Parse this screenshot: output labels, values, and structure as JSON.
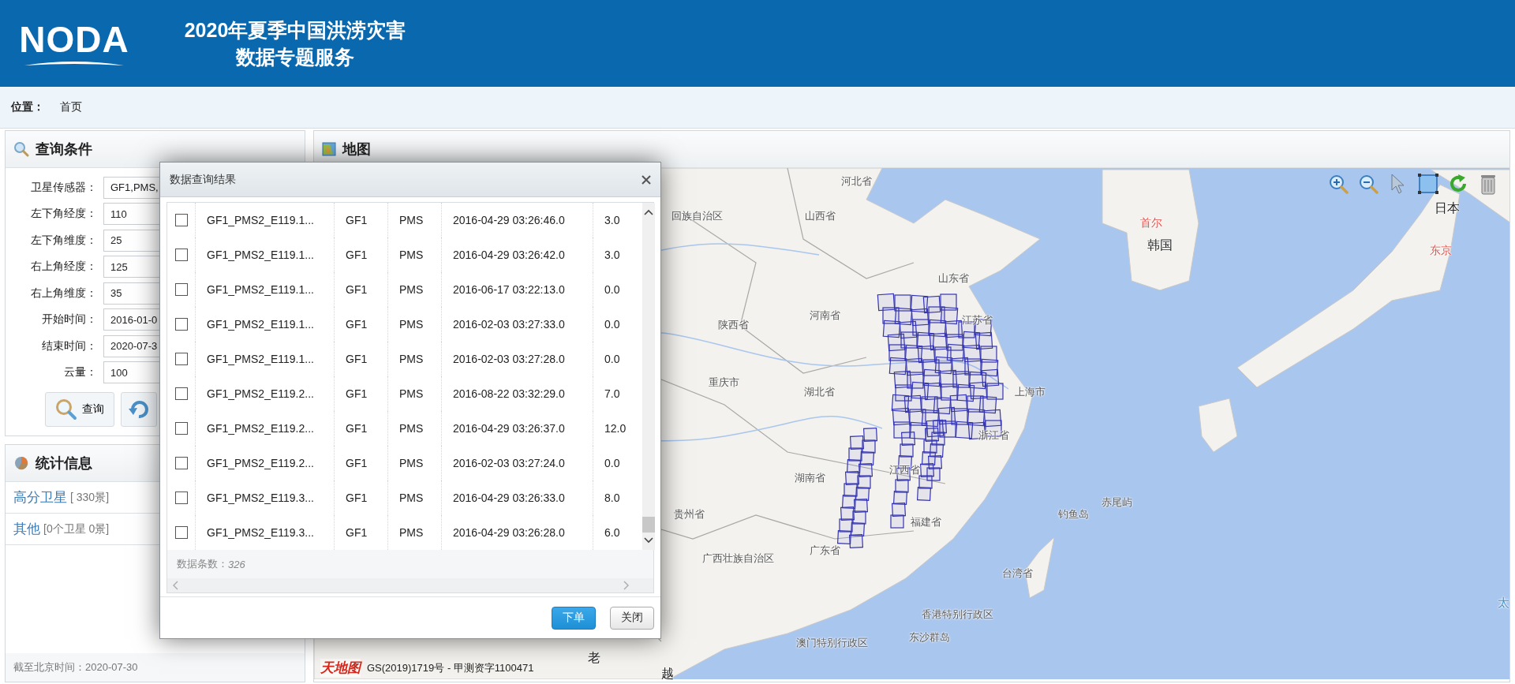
{
  "header": {
    "logo": "NODA",
    "title_lines": [
      "2020年夏季中国洪涝灾害",
      "数据专题服务"
    ]
  },
  "breadcrumb": {
    "label": "位置：",
    "current": "首页"
  },
  "query_panel": {
    "title": "查询条件",
    "fields": [
      {
        "label": "卫星传感器：",
        "value": "GF1,PMS,"
      },
      {
        "label": "左下角经度：",
        "value": "110"
      },
      {
        "label": "左下角维度：",
        "value": "25"
      },
      {
        "label": "右上角经度：",
        "value": "125"
      },
      {
        "label": "右上角维度：",
        "value": "35"
      },
      {
        "label": "开始时间：",
        "value": "2016-01-0"
      },
      {
        "label": "结束时间：",
        "value": "2020-07-3"
      },
      {
        "label": "云量：",
        "value": "100"
      }
    ],
    "search_button": "查询"
  },
  "stats_panel": {
    "title": "统计信息",
    "items": [
      {
        "name": "高分卫星",
        "detail": "[ 330景]"
      },
      {
        "name": "其他",
        "detail": "[0个卫星 0景]"
      }
    ],
    "footer": "截至北京时间：2020-07-30"
  },
  "map_panel": {
    "title": "地图",
    "labels": [
      {
        "text": "河北省",
        "kind": "region"
      },
      {
        "text": "山西省",
        "kind": "region"
      },
      {
        "text": "回族自治区",
        "kind": "region"
      },
      {
        "text": "山东省",
        "kind": "region"
      },
      {
        "text": "河南省",
        "kind": "region"
      },
      {
        "text": "江苏省",
        "kind": "region"
      },
      {
        "text": "陕西省",
        "kind": "region"
      },
      {
        "text": "重庆市",
        "kind": "region"
      },
      {
        "text": "湖北省",
        "kind": "region"
      },
      {
        "text": "上海市",
        "kind": "region"
      },
      {
        "text": "浙江省",
        "kind": "region"
      },
      {
        "text": "湖南省",
        "kind": "region"
      },
      {
        "text": "江西省",
        "kind": "region"
      },
      {
        "text": "贵州省",
        "kind": "region"
      },
      {
        "text": "福建省",
        "kind": "region"
      },
      {
        "text": "广西壮族自治区",
        "kind": "region"
      },
      {
        "text": "广东省",
        "kind": "region"
      },
      {
        "text": "钓鱼岛",
        "kind": "region"
      },
      {
        "text": "赤尾屿",
        "kind": "region"
      },
      {
        "text": "台湾省",
        "kind": "region"
      },
      {
        "text": "香港特别行政区",
        "kind": "region"
      },
      {
        "text": "澳门特别行政区",
        "kind": "region"
      },
      {
        "text": "东沙群岛",
        "kind": "region"
      },
      {
        "text": "首尔",
        "kind": "city"
      },
      {
        "text": "韩国",
        "kind": "country"
      },
      {
        "text": "日本",
        "kind": "country"
      },
      {
        "text": "东京",
        "kind": "city"
      },
      {
        "text": "太",
        "kind": "ocean"
      },
      {
        "text": "老",
        "kind": "country"
      },
      {
        "text": "越",
        "kind": "country"
      }
    ],
    "attribution": {
      "logo": "天地图",
      "text": "GS(2019)1719号 - 甲测资字1100471"
    }
  },
  "dialog": {
    "title": "数据查询结果",
    "rows": [
      {
        "checked": false,
        "name": "GF1_PMS2_E119.1...",
        "satellite": "GF1",
        "sensor": "PMS",
        "time": "2016-04-29 03:26:46.0",
        "cloud": "3.0"
      },
      {
        "checked": false,
        "name": "GF1_PMS2_E119.1...",
        "satellite": "GF1",
        "sensor": "PMS",
        "time": "2016-04-29 03:26:42.0",
        "cloud": "3.0"
      },
      {
        "checked": false,
        "name": "GF1_PMS2_E119.1...",
        "satellite": "GF1",
        "sensor": "PMS",
        "time": "2016-06-17 03:22:13.0",
        "cloud": "0.0"
      },
      {
        "checked": false,
        "name": "GF1_PMS2_E119.1...",
        "satellite": "GF1",
        "sensor": "PMS",
        "time": "2016-02-03 03:27:33.0",
        "cloud": "0.0"
      },
      {
        "checked": false,
        "name": "GF1_PMS2_E119.1...",
        "satellite": "GF1",
        "sensor": "PMS",
        "time": "2016-02-03 03:27:28.0",
        "cloud": "0.0"
      },
      {
        "checked": false,
        "name": "GF1_PMS2_E119.2...",
        "satellite": "GF1",
        "sensor": "PMS",
        "time": "2016-08-22 03:32:29.0",
        "cloud": "7.0"
      },
      {
        "checked": false,
        "name": "GF1_PMS2_E119.2...",
        "satellite": "GF1",
        "sensor": "PMS",
        "time": "2016-04-29 03:26:37.0",
        "cloud": "12.0"
      },
      {
        "checked": false,
        "name": "GF1_PMS2_E119.2...",
        "satellite": "GF1",
        "sensor": "PMS",
        "time": "2016-02-03 03:27:24.0",
        "cloud": "0.0"
      },
      {
        "checked": false,
        "name": "GF1_PMS2_E119.3...",
        "satellite": "GF1",
        "sensor": "PMS",
        "time": "2016-04-29 03:26:33.0",
        "cloud": "8.0"
      },
      {
        "checked": false,
        "name": "GF1_PMS2_E119.3...",
        "satellite": "GF1",
        "sensor": "PMS",
        "time": "2016-04-29 03:26:28.0",
        "cloud": "6.0"
      }
    ],
    "count_label": "数据条数：",
    "count": "326",
    "buttons": [
      {
        "label": "下单",
        "kind": "primary"
      },
      {
        "label": "关闭",
        "kind": "default"
      }
    ]
  }
}
